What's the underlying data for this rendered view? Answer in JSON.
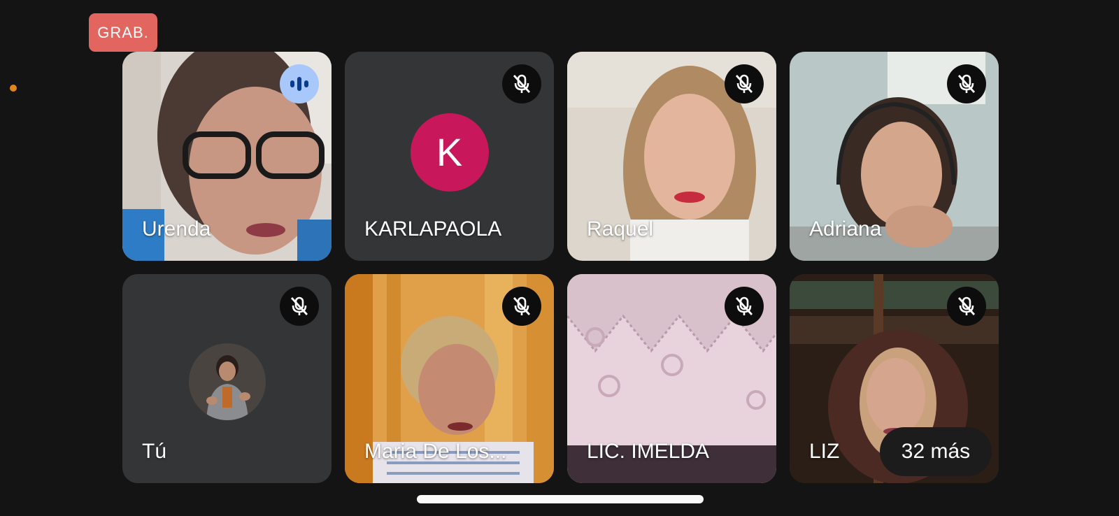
{
  "recording_badge": "GRAB.",
  "colors": {
    "background": "#141414",
    "tile": "#333537",
    "recording": "#e2665f",
    "speaking_indicator": "#a8c7fa",
    "avatar_k": "#c8185b",
    "status_dot": "#e0861a"
  },
  "participants": [
    {
      "name": "Urenda",
      "state": "speaking",
      "view": "video"
    },
    {
      "name": "KARLAPAOLA",
      "state": "muted",
      "view": "avatar",
      "initial": "K"
    },
    {
      "name": "Raquel",
      "state": "muted",
      "view": "video"
    },
    {
      "name": "Adriana",
      "state": "muted",
      "view": "video"
    },
    {
      "name": "Tú",
      "state": "muted",
      "view": "profile-photo"
    },
    {
      "name": "Maria De Los...",
      "state": "muted",
      "view": "video"
    },
    {
      "name": "LIC. IMELDA",
      "state": "muted",
      "view": "video"
    },
    {
      "name": "LIZ",
      "state": "muted",
      "view": "video"
    }
  ],
  "more_participants": "32 más",
  "icons": {
    "speaking": "audio-level-icon",
    "muted": "mic-off-icon"
  }
}
